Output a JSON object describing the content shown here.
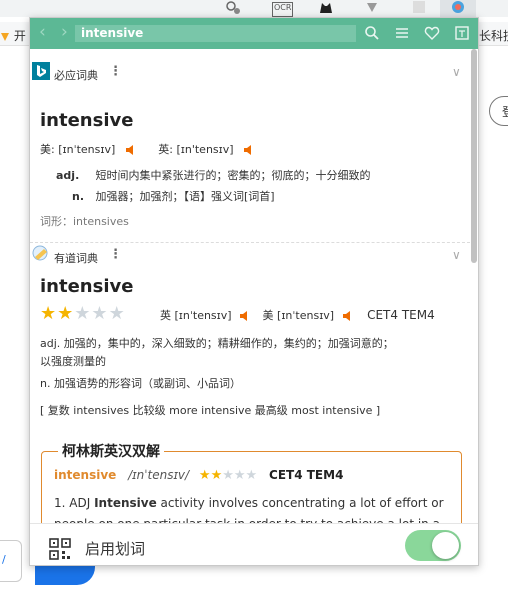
{
  "background": {
    "ext_ocr": "OCR",
    "bookmark_left": "开",
    "bookmark_right": "长科技·",
    "side_button": "登"
  },
  "header": {
    "search_value": "intensive",
    "back_icon": "chevron-left-icon",
    "forward_icon": "chevron-right-icon",
    "icons": [
      "search-icon",
      "menu-icon",
      "heart-icon",
      "book-icon"
    ],
    "color": "#5cb895"
  },
  "bing": {
    "name": "必应词典",
    "word": "intensive",
    "us_label": "美:",
    "us_phonetic": "[ɪnˈtensɪv]",
    "uk_label": "英:",
    "uk_phonetic": "[ɪn'tensɪv]",
    "definitions": [
      {
        "pos": "adj.",
        "text": "短时间内集中紧张进行的；密集的；彻底的；十分细致的"
      },
      {
        "pos": "n.",
        "text": "加强器；加强剂；【语】强义词[词首]"
      }
    ],
    "forms": "词形：intensives"
  },
  "youdao": {
    "name": "有道词典",
    "word": "intensive",
    "rating": 2,
    "rating_max": 5,
    "uk_label": "英",
    "uk_phonetic": "[ɪnˈtensɪv]",
    "us_label": "美",
    "us_phonetic": "[ɪnˈtensɪv]",
    "tags": "CET4 TEM4",
    "adj_line1": "adj. 加强的，集中的，深入细致的；精耕细作的，集约的；加强词意的；",
    "adj_line2": "以强度测量的",
    "noun_line": "n. 加强语势的形容词（或副词、小品词）",
    "forms": "[ 复数 intensives 比较级 more intensive 最高级 most intensive ]"
  },
  "collins": {
    "title": "柯林斯英汉双解",
    "word": "intensive",
    "phonetic": "/ɪnˈtensɪv/",
    "rating": 2,
    "rating_max": 5,
    "tags": "CET4 TEM4",
    "def_prefix": "1. ADJ ",
    "def_keyword": "Intensive",
    "def_text": " activity involves concentrating a lot of effort or people on one particular task in order to try to achieve a lot in a"
  },
  "footer": {
    "label": "启用划词",
    "toggle_on": true,
    "toggle_color": "#8ad79a"
  }
}
